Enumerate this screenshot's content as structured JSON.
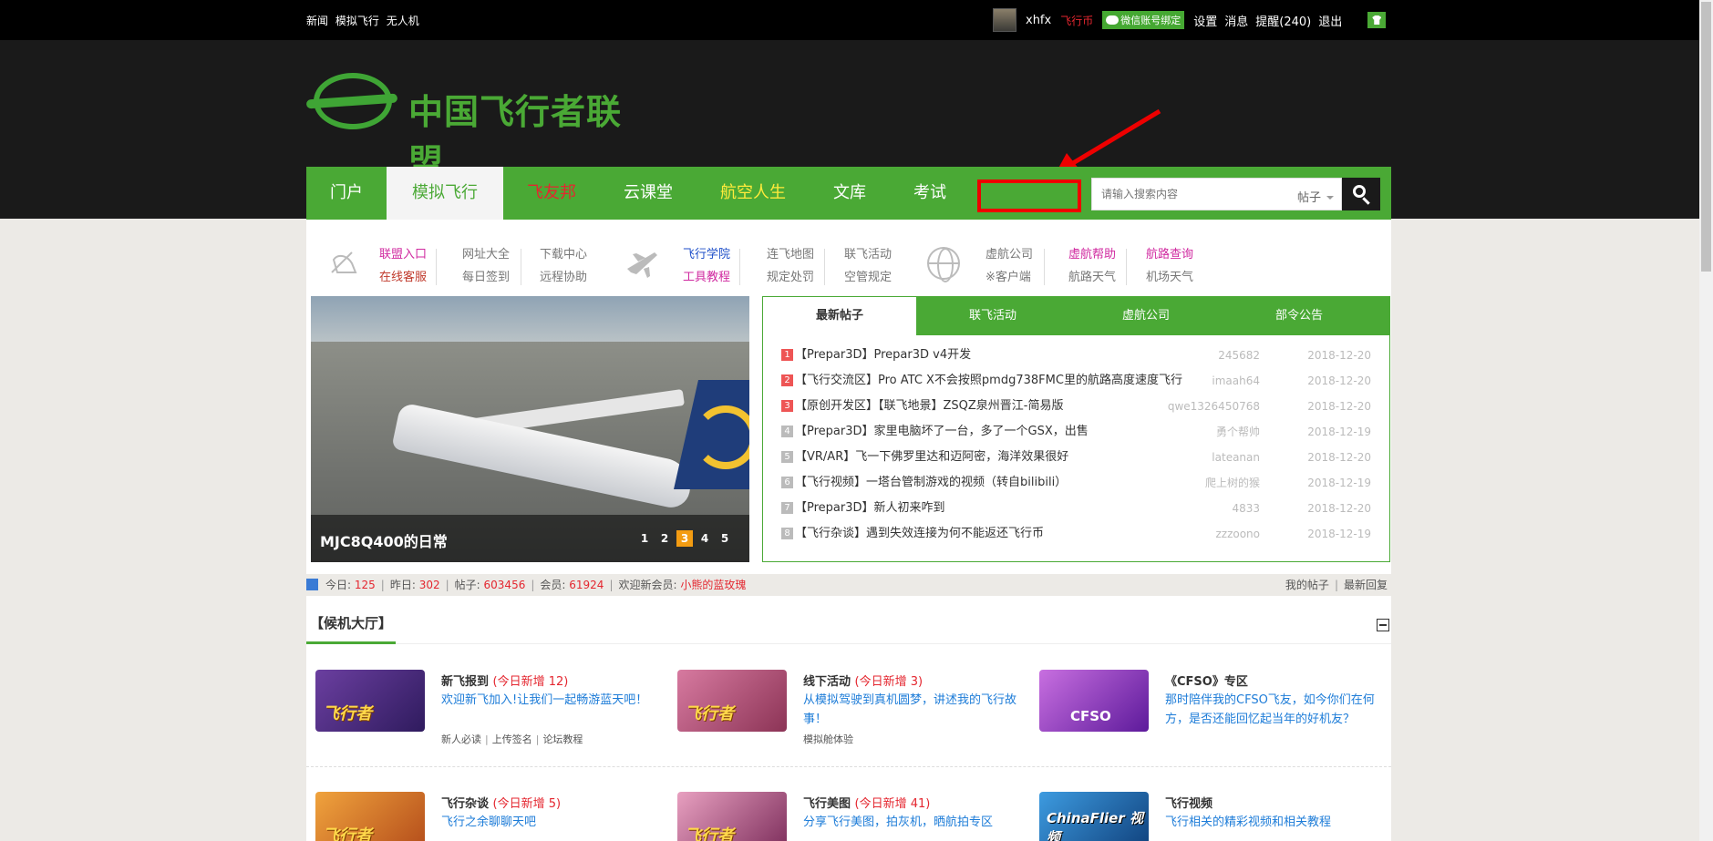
{
  "topbar": {
    "left_links": [
      "新闻",
      "模拟飞行",
      "无人机"
    ],
    "username": "xhfx",
    "coin": "飞行币",
    "wechat": "微信账号绑定",
    "links": [
      "设置",
      "消息",
      "提醒(240)",
      "退出"
    ]
  },
  "logo": {
    "title": "中国飞行者联盟"
  },
  "nav": {
    "items": [
      "门户",
      "模拟飞行",
      "飞友邦",
      "云课堂",
      "航空人生",
      "文库",
      "考试"
    ],
    "search_placeholder": "请输入搜索内容",
    "search_type": "帖子"
  },
  "quick": {
    "g1c1": [
      "联盟入口",
      "在线客服"
    ],
    "g1c2": [
      "网址大全",
      "每日签到"
    ],
    "g1c3": [
      "下载中心",
      "远程协助"
    ],
    "g2c1": [
      "飞行学院",
      "工具教程"
    ],
    "g2c2": [
      "连飞地图",
      "规定处罚"
    ],
    "g2c3": [
      "联飞活动",
      "空管规定"
    ],
    "g3c1": [
      "虚航公司",
      "※客户端"
    ],
    "g3c2": [
      "虚航帮助",
      "航路天气"
    ],
    "g3c3": [
      "航路查询",
      "机场天气"
    ]
  },
  "slider": {
    "caption": "MJC8Q400的日常",
    "pages": [
      "1",
      "2",
      "3",
      "4",
      "5"
    ],
    "active_page": 3
  },
  "tabs": {
    "labels": [
      "最新帖子",
      "联飞活动",
      "虚航公司",
      "部令公告"
    ],
    "posts": [
      {
        "n": "1",
        "title": "【Prepar3D】Prepar3D v4开发",
        "author": "245682",
        "date": "2018-12-20"
      },
      {
        "n": "2",
        "title": "【飞行交流区】Pro ATC X不会按照pmdg738FMC里的航路高度速度飞行",
        "author": "imaah64",
        "date": "2018-12-20"
      },
      {
        "n": "3",
        "title": "【原创开发区】【联飞地景】ZSQZ泉州晋江-简易版",
        "author": "qwe1326450768",
        "date": "2018-12-20"
      },
      {
        "n": "4",
        "title": "【Prepar3D】家里电脑坏了一台，多了一个GSX，出售",
        "author": "勇个帮帅",
        "date": "2018-12-19"
      },
      {
        "n": "5",
        "title": "【VR/AR】飞一下佛罗里达和迈阿密，海洋效果很好",
        "author": "lateanan",
        "date": "2018-12-20"
      },
      {
        "n": "6",
        "title": "【飞行视频】一塔台管制游戏的视频（转自bilibili）",
        "author": "爬上树的猴",
        "date": "2018-12-19"
      },
      {
        "n": "7",
        "title": "【Prepar3D】新人初来咋到",
        "author": "4833",
        "date": "2018-12-20"
      },
      {
        "n": "8",
        "title": "【飞行杂谈】遇到失效连接为何不能返还飞行币",
        "author": "zzzoono",
        "date": "2018-12-19"
      }
    ]
  },
  "stats": {
    "today_label": "今日:",
    "today": "125",
    "yesterday_label": "昨日:",
    "yesterday": "302",
    "posts_label": "帖子:",
    "posts": "603456",
    "members_label": "会员:",
    "members": "61924",
    "welcome_label": "欢迎新会员:",
    "new_member": "小熊的蓝玫瑰",
    "my_posts": "我的帖子",
    "latest_reply": "最新回复"
  },
  "lobby": {
    "title": "【候机大厅】",
    "forums": [
      {
        "name": "新飞报到",
        "today": "(今日新增 12)",
        "desc": "欢迎新飞加入!让我们一起畅游蓝天吧！",
        "sub": [
          "新人必读",
          "上传签名",
          "论坛教程"
        ],
        "badge": "飞行者"
      },
      {
        "name": "线下活动",
        "today": "(今日新增 3)",
        "desc": "从模拟驾驶到真机圆梦，讲述我的飞行故事！",
        "sub": [
          "模拟舱体验"
        ],
        "badge": "飞行者"
      },
      {
        "name": "《CFSO》专区",
        "today": "",
        "desc": "那时陪伴我的CFSO飞友，如今你们在何方，是否还能回忆起当年的好机友？",
        "sub": [],
        "badge": "CFSO"
      },
      {
        "name": "飞行杂谈",
        "today": "(今日新增 5)",
        "desc": "飞行之余聊聊天吧",
        "sub": [],
        "badge": "飞行者"
      },
      {
        "name": "飞行美图",
        "today": "(今日新增 41)",
        "desc": "分享飞行美图，拍灰机，晒航拍专区",
        "sub": [],
        "badge": "飞行者"
      },
      {
        "name": "飞行视频",
        "today": "",
        "desc": "飞行相关的精彩视频和相关教程",
        "sub": [],
        "badge": "ChinaFlier 视频"
      }
    ]
  }
}
